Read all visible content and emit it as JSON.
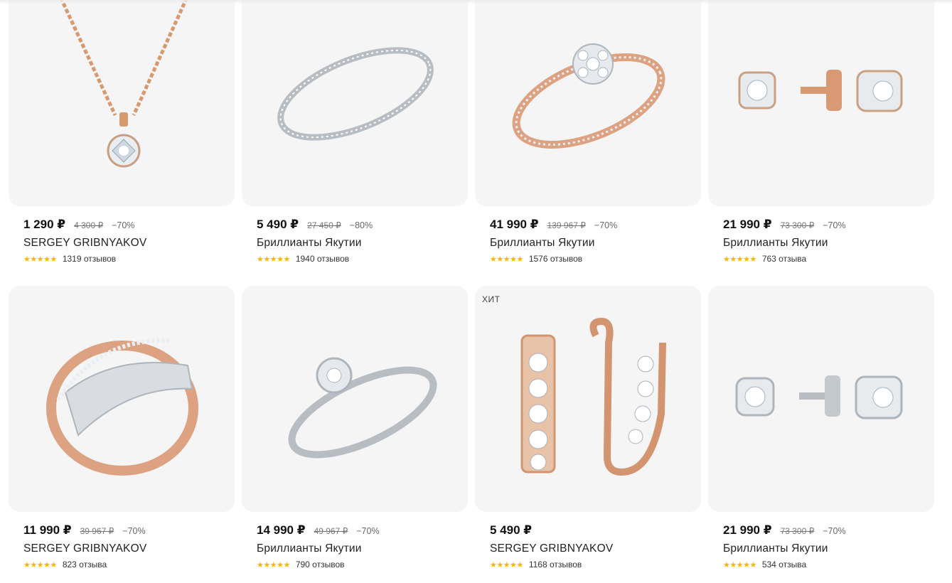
{
  "products": [
    {
      "price": "1 290 ₽",
      "old_price": "4 300 ₽",
      "discount": "−70%",
      "brand": "SERGEY GRIBNYAKOV",
      "stars": "★★★★★",
      "reviews": "1319 отзывов",
      "badge": "",
      "image": "pendant-icon"
    },
    {
      "price": "5 490 ₽",
      "old_price": "27 450 ₽",
      "discount": "−80%",
      "brand": "Бриллианты Якутии",
      "stars": "★★★★★",
      "reviews": "1940 отзывов",
      "badge": "",
      "image": "silver-band-ring-icon"
    },
    {
      "price": "41 990 ₽",
      "old_price": "139 967 ₽",
      "discount": "−70%",
      "brand": "Бриллианты Якутии",
      "stars": "★★★★★",
      "reviews": "1576 отзывов",
      "badge": "",
      "image": "cluster-ring-icon"
    },
    {
      "price": "21 990 ₽",
      "old_price": "73 300 ₽",
      "discount": "−70%",
      "brand": "Бриллианты Якутии",
      "stars": "★★★★★",
      "reviews": "763 отзыва",
      "badge": "",
      "image": "gold-stud-earrings-icon"
    },
    {
      "price": "11 990 ₽",
      "old_price": "39 967 ₽",
      "discount": "−70%",
      "brand": "SERGEY GRIBNYAKOV",
      "stars": "★★★★★",
      "reviews": "823 отзыва",
      "badge": "",
      "image": "twotone-ring-icon"
    },
    {
      "price": "14 990 ₽",
      "old_price": "49 967 ₽",
      "discount": "−70%",
      "brand": "Бриллианты Якутии",
      "stars": "★★★★★",
      "reviews": "790 отзывов",
      "badge": "",
      "image": "solitaire-ring-icon"
    },
    {
      "price": "5 490 ₽",
      "old_price": "",
      "discount": "",
      "brand": "SERGEY GRIBNYAKOV",
      "stars": "★★★★★",
      "reviews": "1168 отзывов",
      "badge": "ХИТ",
      "image": "hoop-earrings-icon"
    },
    {
      "price": "21 990 ₽",
      "old_price": "73 300 ₽",
      "discount": "−70%",
      "brand": "Бриллианты Якутии",
      "stars": "★★★★★",
      "reviews": "534 отзыва",
      "badge": "",
      "image": "silver-stud-earrings-icon"
    }
  ],
  "colors": {
    "card_bg": "#f5f5f5",
    "star": "#f5b800",
    "gold": "#d99a73",
    "silver": "#b9bec4"
  }
}
